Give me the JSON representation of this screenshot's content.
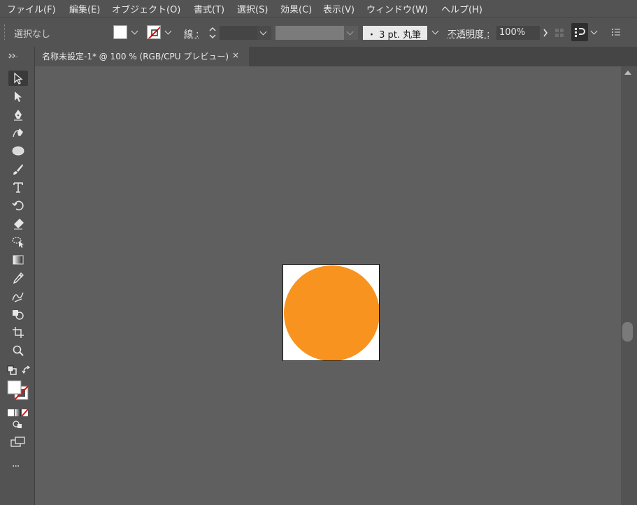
{
  "menu": [
    "ファイル(F)",
    "編集(E)",
    "オブジェクト(O)",
    "書式(T)",
    "選択(S)",
    "効果(C)",
    "表示(V)",
    "ウィンドウ(W)",
    "ヘルプ(H)"
  ],
  "control": {
    "selection": "選択なし",
    "stroke_label": "線 :",
    "brush": "・ 3 pt. 丸筆",
    "opacity_label": "不透明度 :",
    "opacity_value": "100%"
  },
  "tab": {
    "title": "名称未設定-1* @ 100 % (RGB/CPU プレビュー)",
    "close": "×"
  },
  "toolbar": {
    "more": "···"
  },
  "artboard": {
    "circle_color": "#F7931E",
    "background_color": "#FFFFFF"
  },
  "icons": [
    "selection-tool",
    "direct-selection-tool",
    "pen-tool",
    "curvature-tool",
    "ellipse-tool",
    "paintbrush-tool",
    "type-tool",
    "rotate-tool",
    "eraser-tool",
    "lasso-tool",
    "gradient-tool",
    "eyedropper-tool",
    "blend-tool",
    "shape-builder-tool",
    "artboard-tool",
    "zoom-tool"
  ]
}
